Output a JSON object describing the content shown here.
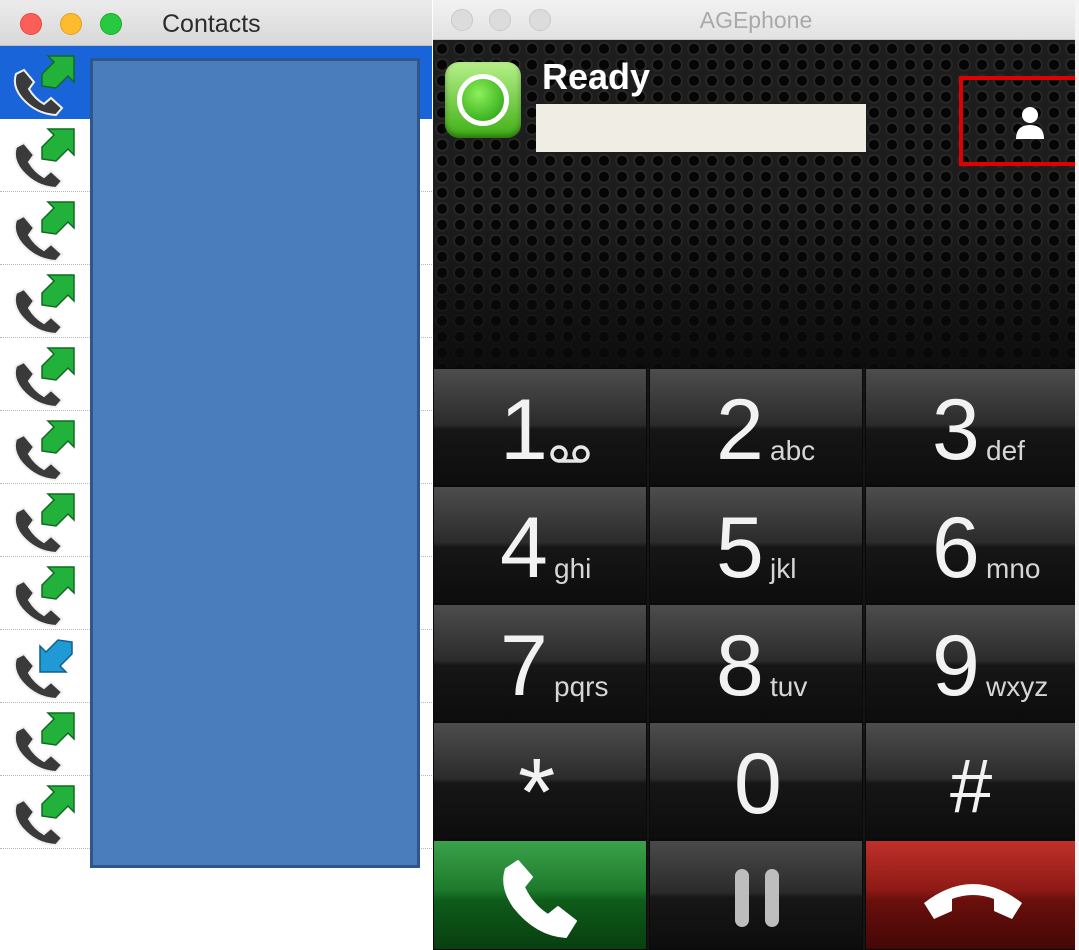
{
  "contacts_window": {
    "title": "Contacts",
    "rows": [
      {
        "direction": "outgoing",
        "selected": true
      },
      {
        "direction": "outgoing",
        "selected": false
      },
      {
        "direction": "outgoing",
        "selected": false
      },
      {
        "direction": "outgoing",
        "selected": false
      },
      {
        "direction": "outgoing",
        "selected": false
      },
      {
        "direction": "outgoing",
        "selected": false
      },
      {
        "direction": "outgoing",
        "selected": false
      },
      {
        "direction": "outgoing",
        "selected": false
      },
      {
        "direction": "incoming",
        "selected": false
      },
      {
        "direction": "outgoing",
        "selected": false
      },
      {
        "direction": "outgoing",
        "selected": false
      }
    ]
  },
  "phone_window": {
    "title": "AGEphone",
    "status": {
      "text": "Ready",
      "color": "#3fae15"
    },
    "contacts_button_icon": "person-icon",
    "highlight_color": "#e00000",
    "keypad": [
      {
        "digit": "1",
        "letters": "",
        "icon": "voicemail-icon"
      },
      {
        "digit": "2",
        "letters": "abc"
      },
      {
        "digit": "3",
        "letters": "def"
      },
      {
        "digit": "4",
        "letters": "ghi"
      },
      {
        "digit": "5",
        "letters": "jkl"
      },
      {
        "digit": "6",
        "letters": "mno"
      },
      {
        "digit": "7",
        "letters": "pqrs"
      },
      {
        "digit": "8",
        "letters": "tuv"
      },
      {
        "digit": "9",
        "letters": "wxyz"
      },
      {
        "digit": "*",
        "letters": ""
      },
      {
        "digit": "0",
        "letters": ""
      },
      {
        "digit": "#",
        "letters": ""
      }
    ],
    "call_buttons": [
      {
        "name": "call",
        "icon": "phone-icon",
        "color": "#1e7a2c"
      },
      {
        "name": "hold",
        "icon": "pause-icon",
        "color": "#2a2a2a"
      },
      {
        "name": "hang-up",
        "icon": "hang-up-icon",
        "color": "#8e1a16"
      }
    ]
  },
  "colors": {
    "outgoing_arrow": "#22b13a",
    "incoming_arrow": "#1f9ad6",
    "selection": "#1a64d9"
  }
}
